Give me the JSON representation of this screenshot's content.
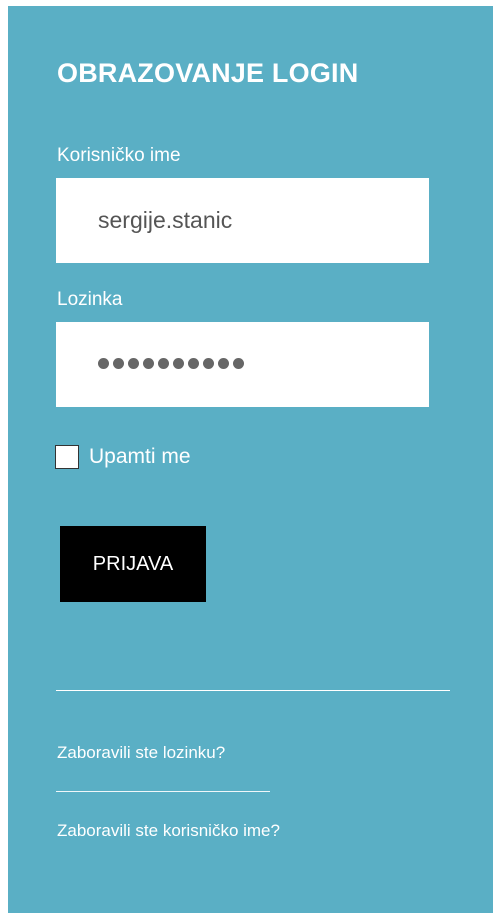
{
  "login": {
    "title": "OBRAZOVANJE LOGIN",
    "username_label": "Korisničko ime",
    "username_value": "sergije.stanic",
    "password_label": "Lozinka",
    "password_mask_count": 10,
    "remember_label": "Upamti me",
    "remember_checked": false,
    "submit_label": "PRIJAVA"
  },
  "links": {
    "forgot_password": "Zaboravili ste lozinku?",
    "forgot_username": "Zaboravili ste korisničko ime?"
  },
  "colors": {
    "panel_background": "#5aafc5",
    "button_background": "#000000",
    "text": "#ffffff"
  }
}
